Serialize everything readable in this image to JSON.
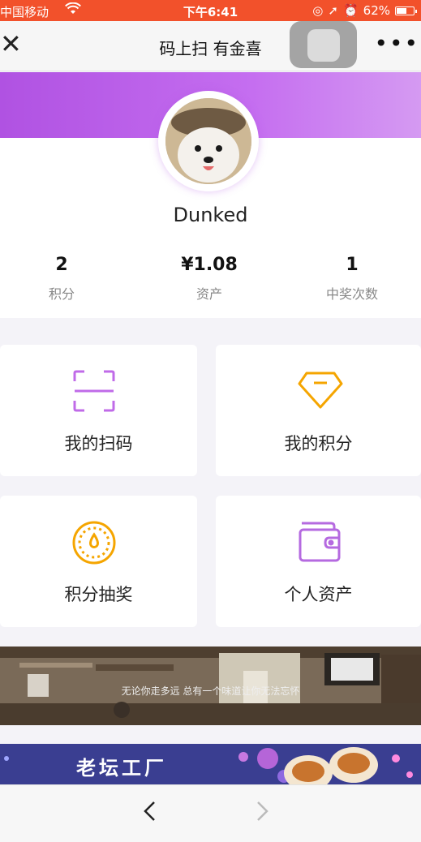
{
  "status_bar": {
    "carrier": "中国移动",
    "time": "下午6:41",
    "battery": "62%",
    "battery_level": 0.62
  },
  "nav": {
    "close_icon": "close-icon",
    "title": "码上扫 有金喜",
    "more_icon": "more-icon"
  },
  "profile": {
    "username": "Dunked",
    "stats": [
      {
        "value": "2",
        "label": "积分"
      },
      {
        "value": "¥1.08",
        "label": "资产"
      },
      {
        "value": "1",
        "label": "中奖次数"
      }
    ]
  },
  "menu": [
    {
      "label": "我的扫码",
      "icon": "scan-icon",
      "color": "#c06be8"
    },
    {
      "label": "我的积分",
      "icon": "diamond-icon",
      "color": "#f5a500"
    },
    {
      "label": "积分抽奖",
      "icon": "lottery-dial-icon",
      "color": "#f5a500"
    },
    {
      "label": "个人资产",
      "icon": "wallet-icon",
      "color": "#b56ae0"
    }
  ],
  "photo_banner": {
    "caption": "无论你走多远 总有一个味道让你无法忘怀"
  },
  "ad_banner": {
    "title": "老坛工厂"
  },
  "colors": {
    "status_bar": "#f2512b",
    "header_purple": "#b052e2",
    "accent_orange": "#f5a500"
  }
}
